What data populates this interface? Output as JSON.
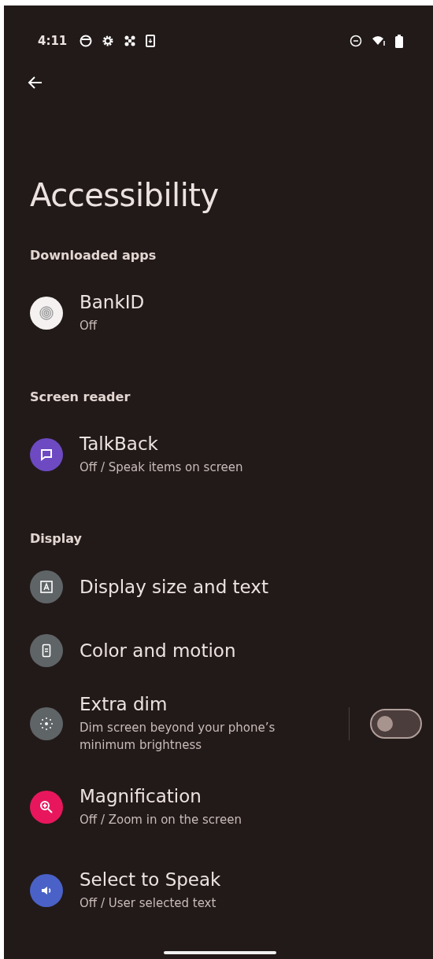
{
  "status_bar": {
    "time": "4:11"
  },
  "title": "Accessibility",
  "sections": [
    {
      "heading": "Downloaded apps",
      "items": [
        {
          "kind": "link",
          "color": "#f4f1f0",
          "title": "BankID",
          "subtitle": "Off"
        }
      ]
    },
    {
      "heading": "Screen reader",
      "items": [
        {
          "kind": "link",
          "color": "#6d4ac2",
          "title": "TalkBack",
          "subtitle": "Off / Speak items on screen"
        }
      ]
    },
    {
      "heading": "Display",
      "items": [
        {
          "kind": "link",
          "color": "#5f6467",
          "title": "Display size and text"
        },
        {
          "kind": "link",
          "color": "#5f6467",
          "title": "Color and motion"
        },
        {
          "kind": "toggle",
          "color": "#5f6467",
          "title": "Extra dim",
          "subtitle": "Dim screen beyond your phone’s minimum brightness",
          "on": false
        },
        {
          "kind": "link",
          "color": "#e8175d",
          "title": "Magnification",
          "subtitle": "Off / Zoom in on the screen"
        },
        {
          "kind": "link",
          "color": "#4a62c8",
          "title": "Select to Speak",
          "subtitle": "Off / User selected text"
        }
      ]
    }
  ]
}
